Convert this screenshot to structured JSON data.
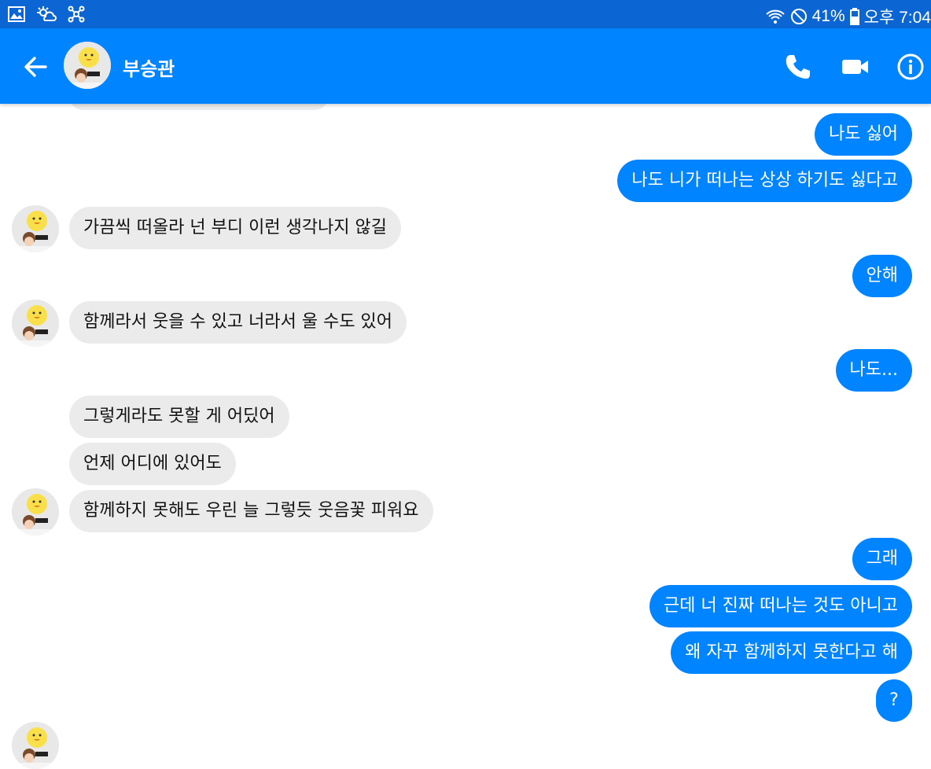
{
  "status_bar": {
    "battery": "41%",
    "time": "오후 7:04"
  },
  "header": {
    "contact_name": "부승관"
  },
  "messages": [
    {
      "side": "out",
      "text": "나도 싫어"
    },
    {
      "side": "out",
      "text": "나도 니가 떠나는 상상 하기도 싫다고"
    },
    {
      "side": "in",
      "text": "가끔씩 떠올라 넌 부디 이런 생각나지 않길"
    },
    {
      "side": "out",
      "text": "안해"
    },
    {
      "side": "in",
      "text": "함께라서 웃을 수 있고 너라서 울 수도 있어"
    },
    {
      "side": "out",
      "text": "나도..."
    },
    {
      "side": "in",
      "text": "그렇게라도 못할 게 어딨어"
    },
    {
      "side": "in",
      "text": "언제 어디에 있어도"
    },
    {
      "side": "in",
      "text": "함께하지 못해도 우린 늘 그렇듯 웃음꽃 피워요"
    },
    {
      "side": "out",
      "text": "그래"
    },
    {
      "side": "out",
      "text": "근데 너 진짜 떠나는 것도 아니고"
    },
    {
      "side": "out",
      "text": "왜 자꾸 함께하지 못한다고 해"
    },
    {
      "side": "out",
      "text": "?"
    }
  ],
  "colors": {
    "accent": "#0084ff",
    "status_bar": "#0b65d3",
    "incoming_bubble": "#ebebeb"
  },
  "icons": [
    "image-icon",
    "weather-icon",
    "network-icon",
    "wifi-icon",
    "do-not-disturb-icon",
    "battery-icon",
    "back-arrow-icon",
    "phone-icon",
    "video-call-icon",
    "info-icon"
  ]
}
